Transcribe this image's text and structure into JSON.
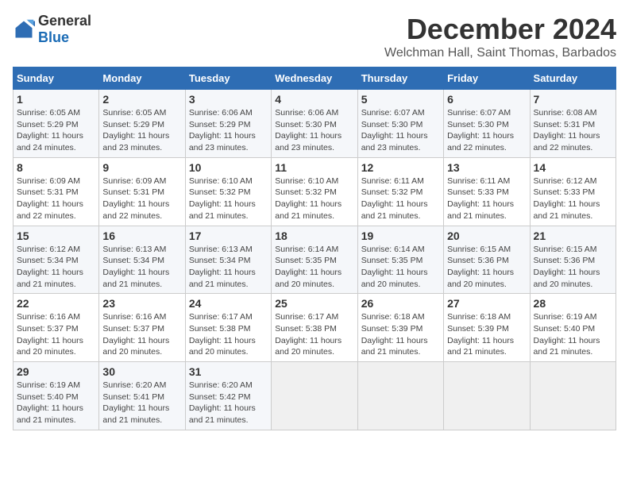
{
  "logo": {
    "general": "General",
    "blue": "Blue"
  },
  "title": "December 2024",
  "subtitle": "Welchman Hall, Saint Thomas, Barbados",
  "weekdays": [
    "Sunday",
    "Monday",
    "Tuesday",
    "Wednesday",
    "Thursday",
    "Friday",
    "Saturday"
  ],
  "weeks": [
    [
      {
        "day": "1",
        "info": "Sunrise: 6:05 AM\nSunset: 5:29 PM\nDaylight: 11 hours\nand 24 minutes."
      },
      {
        "day": "2",
        "info": "Sunrise: 6:05 AM\nSunset: 5:29 PM\nDaylight: 11 hours\nand 23 minutes."
      },
      {
        "day": "3",
        "info": "Sunrise: 6:06 AM\nSunset: 5:29 PM\nDaylight: 11 hours\nand 23 minutes."
      },
      {
        "day": "4",
        "info": "Sunrise: 6:06 AM\nSunset: 5:30 PM\nDaylight: 11 hours\nand 23 minutes."
      },
      {
        "day": "5",
        "info": "Sunrise: 6:07 AM\nSunset: 5:30 PM\nDaylight: 11 hours\nand 23 minutes."
      },
      {
        "day": "6",
        "info": "Sunrise: 6:07 AM\nSunset: 5:30 PM\nDaylight: 11 hours\nand 22 minutes."
      },
      {
        "day": "7",
        "info": "Sunrise: 6:08 AM\nSunset: 5:31 PM\nDaylight: 11 hours\nand 22 minutes."
      }
    ],
    [
      {
        "day": "8",
        "info": "Sunrise: 6:09 AM\nSunset: 5:31 PM\nDaylight: 11 hours\nand 22 minutes."
      },
      {
        "day": "9",
        "info": "Sunrise: 6:09 AM\nSunset: 5:31 PM\nDaylight: 11 hours\nand 22 minutes."
      },
      {
        "day": "10",
        "info": "Sunrise: 6:10 AM\nSunset: 5:32 PM\nDaylight: 11 hours\nand 21 minutes."
      },
      {
        "day": "11",
        "info": "Sunrise: 6:10 AM\nSunset: 5:32 PM\nDaylight: 11 hours\nand 21 minutes."
      },
      {
        "day": "12",
        "info": "Sunrise: 6:11 AM\nSunset: 5:32 PM\nDaylight: 11 hours\nand 21 minutes."
      },
      {
        "day": "13",
        "info": "Sunrise: 6:11 AM\nSunset: 5:33 PM\nDaylight: 11 hours\nand 21 minutes."
      },
      {
        "day": "14",
        "info": "Sunrise: 6:12 AM\nSunset: 5:33 PM\nDaylight: 11 hours\nand 21 minutes."
      }
    ],
    [
      {
        "day": "15",
        "info": "Sunrise: 6:12 AM\nSunset: 5:34 PM\nDaylight: 11 hours\nand 21 minutes."
      },
      {
        "day": "16",
        "info": "Sunrise: 6:13 AM\nSunset: 5:34 PM\nDaylight: 11 hours\nand 21 minutes."
      },
      {
        "day": "17",
        "info": "Sunrise: 6:13 AM\nSunset: 5:34 PM\nDaylight: 11 hours\nand 21 minutes."
      },
      {
        "day": "18",
        "info": "Sunrise: 6:14 AM\nSunset: 5:35 PM\nDaylight: 11 hours\nand 20 minutes."
      },
      {
        "day": "19",
        "info": "Sunrise: 6:14 AM\nSunset: 5:35 PM\nDaylight: 11 hours\nand 20 minutes."
      },
      {
        "day": "20",
        "info": "Sunrise: 6:15 AM\nSunset: 5:36 PM\nDaylight: 11 hours\nand 20 minutes."
      },
      {
        "day": "21",
        "info": "Sunrise: 6:15 AM\nSunset: 5:36 PM\nDaylight: 11 hours\nand 20 minutes."
      }
    ],
    [
      {
        "day": "22",
        "info": "Sunrise: 6:16 AM\nSunset: 5:37 PM\nDaylight: 11 hours\nand 20 minutes."
      },
      {
        "day": "23",
        "info": "Sunrise: 6:16 AM\nSunset: 5:37 PM\nDaylight: 11 hours\nand 20 minutes."
      },
      {
        "day": "24",
        "info": "Sunrise: 6:17 AM\nSunset: 5:38 PM\nDaylight: 11 hours\nand 20 minutes."
      },
      {
        "day": "25",
        "info": "Sunrise: 6:17 AM\nSunset: 5:38 PM\nDaylight: 11 hours\nand 20 minutes."
      },
      {
        "day": "26",
        "info": "Sunrise: 6:18 AM\nSunset: 5:39 PM\nDaylight: 11 hours\nand 21 minutes."
      },
      {
        "day": "27",
        "info": "Sunrise: 6:18 AM\nSunset: 5:39 PM\nDaylight: 11 hours\nand 21 minutes."
      },
      {
        "day": "28",
        "info": "Sunrise: 6:19 AM\nSunset: 5:40 PM\nDaylight: 11 hours\nand 21 minutes."
      }
    ],
    [
      {
        "day": "29",
        "info": "Sunrise: 6:19 AM\nSunset: 5:40 PM\nDaylight: 11 hours\nand 21 minutes."
      },
      {
        "day": "30",
        "info": "Sunrise: 6:20 AM\nSunset: 5:41 PM\nDaylight: 11 hours\nand 21 minutes."
      },
      {
        "day": "31",
        "info": "Sunrise: 6:20 AM\nSunset: 5:42 PM\nDaylight: 11 hours\nand 21 minutes."
      },
      {
        "day": "",
        "info": ""
      },
      {
        "day": "",
        "info": ""
      },
      {
        "day": "",
        "info": ""
      },
      {
        "day": "",
        "info": ""
      }
    ]
  ]
}
